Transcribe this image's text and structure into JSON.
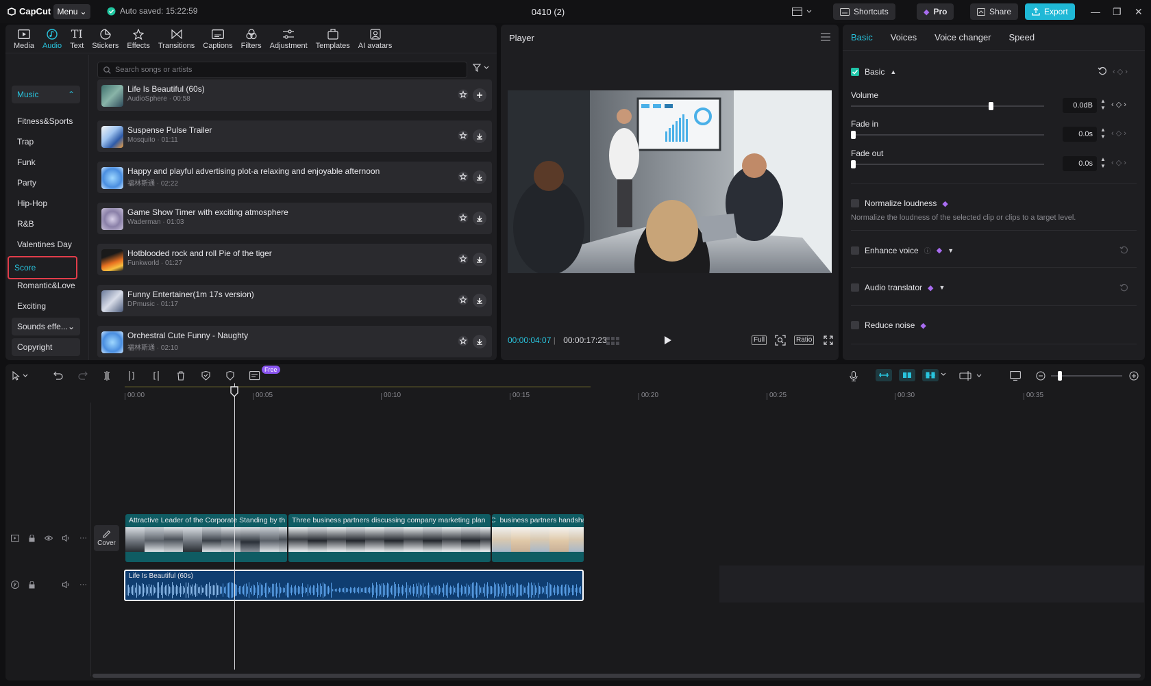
{
  "titlebar": {
    "logo": "CapCut",
    "menu": "Menu",
    "autosave": "Auto saved: 15:22:59",
    "project": "0410 (2)",
    "shortcuts": "Shortcuts",
    "pro": "Pro",
    "share": "Share",
    "export": "Export"
  },
  "toolbar": {
    "items": [
      {
        "label": "Media",
        "icon": "media-icon"
      },
      {
        "label": "Audio",
        "icon": "audio-icon",
        "active": true
      },
      {
        "label": "Text",
        "icon": "text-icon"
      },
      {
        "label": "Stickers",
        "icon": "sticker-icon"
      },
      {
        "label": "Effects",
        "icon": "effects-icon"
      },
      {
        "label": "Transitions",
        "icon": "transitions-icon"
      },
      {
        "label": "Captions",
        "icon": "captions-icon"
      },
      {
        "label": "Filters",
        "icon": "filters-icon"
      },
      {
        "label": "Adjustment",
        "icon": "adjustment-icon"
      },
      {
        "label": "Templates",
        "icon": "templates-icon"
      },
      {
        "label": "AI avatars",
        "icon": "avatar-icon"
      }
    ]
  },
  "categories": {
    "music": "Music",
    "items": [
      "Fitness&Sports",
      "Trap",
      "Funk",
      "Party",
      "Hip-Hop",
      "R&B",
      "Valentines Day",
      "Score",
      "Romantic&Love",
      "Exciting"
    ],
    "selected": "Score",
    "sounds": "Sounds effe...",
    "copyright": "Copyright"
  },
  "search": {
    "placeholder": "Search songs or artists"
  },
  "songs": [
    {
      "title": "Life Is Beautiful (60s)",
      "meta": "AudioSphere · 00:58",
      "action": "add"
    },
    {
      "title": "Suspense Pulse Trailer",
      "meta": "Mosquito · 01:11",
      "action": "download"
    },
    {
      "title": "Happy and playful advertising plot-a relaxing and enjoyable afternoon",
      "meta": "福林斯通 · 02:22",
      "action": "download"
    },
    {
      "title": "Game Show Timer with exciting atmosphere",
      "meta": "Waderman · 01:03",
      "action": "download"
    },
    {
      "title": "Hotblooded rock and roll Pie of the tiger",
      "meta": "Funkworld · 01:27",
      "action": "download"
    },
    {
      "title": "Funny Entertainer(1m 17s version)",
      "meta": "DPmusic · 01:17",
      "action": "download"
    },
    {
      "title": "Orchestral Cute Funny - Naughty",
      "meta": "福林斯通 · 02:10",
      "action": "download"
    }
  ],
  "player": {
    "title": "Player",
    "current": "00:00:04:07",
    "total": "00:00:17:23",
    "full": "Full",
    "ratio": "Ratio"
  },
  "props": {
    "tabs": [
      "Basic",
      "Voices",
      "Voice changer",
      "Speed"
    ],
    "active_tab": "Basic",
    "basic": "Basic",
    "volume": {
      "label": "Volume",
      "value": "0.0dB",
      "level": 0.73
    },
    "fade_in": {
      "label": "Fade in",
      "value": "0.0s",
      "level": 0.0
    },
    "fade_out": {
      "label": "Fade out",
      "value": "0.0s",
      "level": 0.0
    },
    "normalize": {
      "label": "Normalize loudness",
      "desc": "Normalize the loudness of the selected clip or clips to a target level."
    },
    "enhance": {
      "label": "Enhance voice"
    },
    "translator": {
      "label": "Audio translator"
    },
    "noise": {
      "label": "Reduce noise"
    }
  },
  "timeline": {
    "free_badge": "Free",
    "ticks": [
      "00:00",
      "00:05",
      "00:10",
      "00:15",
      "00:20",
      "00:25",
      "00:30",
      "00:35"
    ],
    "cover": "Cover",
    "video_clips": [
      "Attractive Leader of the Corporate Standing by th",
      "Three business partners discussing company marketing plan",
      "C",
      "business partners handshak"
    ],
    "audio_clip": "Life Is Beautiful (60s)"
  },
  "colors": {
    "accent": "#29c4de",
    "export": "#1fb8d6",
    "highlight": "#e23d4a",
    "pro": "#a86cf0"
  }
}
